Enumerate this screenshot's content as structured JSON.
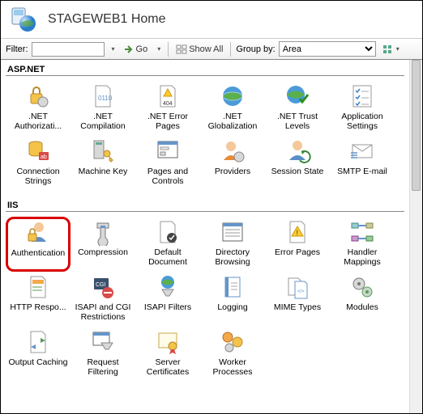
{
  "header": {
    "title": "STAGEWEB1 Home"
  },
  "toolbar": {
    "filter_label": "Filter:",
    "filter_value": "",
    "go_label": "Go",
    "show_all_label": "Show All",
    "group_by_label": "Group by:",
    "group_by_value": "Area"
  },
  "sections": {
    "aspnet": {
      "title": "ASP.NET",
      "items": [
        ".NET Authorizati...",
        ".NET Compilation",
        ".NET Error Pages",
        ".NET Globalization",
        ".NET Trust Levels",
        "Application Settings",
        "Connection Strings",
        "Machine Key",
        "Pages and Controls",
        "Providers",
        "Session State",
        "SMTP E-mail"
      ]
    },
    "iis": {
      "title": "IIS",
      "items": [
        "Authentication",
        "Compression",
        "Default Document",
        "Directory Browsing",
        "Error Pages",
        "Handler Mappings",
        "HTTP Respo...",
        "ISAPI and CGI Restrictions",
        "ISAPI Filters",
        "Logging",
        "MIME Types",
        "Modules",
        "Output Caching",
        "Request Filtering",
        "Server Certificates",
        "Worker Processes"
      ]
    }
  }
}
